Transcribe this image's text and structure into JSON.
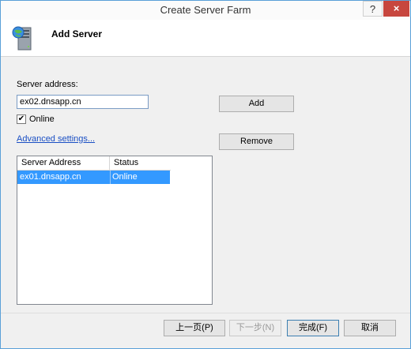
{
  "window": {
    "title": "Create Server Farm",
    "help_label": "?",
    "close_label": "×"
  },
  "header": {
    "title": "Add Server",
    "icon": "server-globe-icon"
  },
  "form": {
    "server_address_label": "Server address:",
    "server_address_value": "ex02.dnsapp.cn",
    "online_checked": true,
    "online_check_mark": "✔",
    "online_label": "Online",
    "advanced_link": "Advanced settings...",
    "add_button": "Add",
    "remove_button": "Remove"
  },
  "server_list": {
    "columns": [
      "Server Address",
      "Status"
    ],
    "rows": [
      {
        "address": "ex01.dnsapp.cn",
        "status": "Online",
        "selected": true
      }
    ]
  },
  "footer": {
    "prev_button": "上一页(P)",
    "next_button": "下一步(N)",
    "finish_button": "完成(F)",
    "cancel_button": "取消"
  },
  "colors": {
    "selection": "#3399ff",
    "close_button": "#c7463e",
    "link": "#1a4fc4"
  }
}
